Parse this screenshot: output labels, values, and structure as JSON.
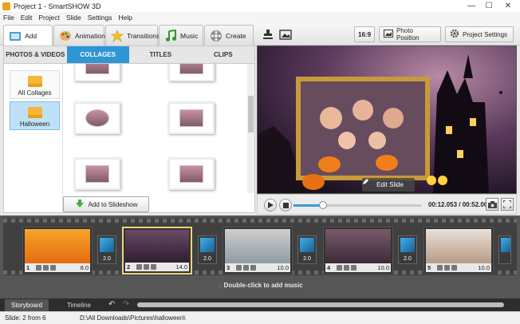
{
  "window": {
    "title": "Project 1 - SmartSHOW 3D",
    "minimize": "—",
    "maximize": "☐",
    "close": "✕"
  },
  "menu": [
    "File",
    "Edit",
    "Project",
    "Slide",
    "Settings",
    "Help"
  ],
  "main_tabs": [
    {
      "label": "Add",
      "icon": "add-media-icon"
    },
    {
      "label": "Animation",
      "icon": "palette-icon"
    },
    {
      "label": "Transitions",
      "icon": "star-icon"
    },
    {
      "label": "Music",
      "icon": "music-note-icon"
    },
    {
      "label": "Create",
      "icon": "film-reel-icon"
    }
  ],
  "toolbar": {
    "aspect_label": "16:9",
    "photo_position_label": "Photo Position",
    "project_settings_label": "Project Settings",
    "tool_icons": [
      "stamp-icon",
      "image-mountain-icon"
    ]
  },
  "sub_tabs": [
    "PHOTOS & VIDEOS",
    "COLLAGES",
    "TITLES",
    "CLIPS"
  ],
  "active_sub_tab": "COLLAGES",
  "categories": [
    {
      "label": "All Collages"
    },
    {
      "label": "Halloween"
    }
  ],
  "add_to_slideshow_label": "Add to Slideshow",
  "preview": {
    "edit_slide_label": "Edit Slide",
    "timecode": "00:12.053 / 00:52.000",
    "progress": 0.23
  },
  "slides": [
    {
      "num": "1",
      "duration": "8.0"
    },
    {
      "num": "2",
      "duration": "14.0"
    },
    {
      "num": "3",
      "duration": "10.0"
    },
    {
      "num": "4",
      "duration": "10.0"
    },
    {
      "num": "5",
      "duration": "10.0"
    }
  ],
  "transitions": [
    "2.0",
    "2.0",
    "2.0",
    "2.0"
  ],
  "music_hint": "Double-click to add music",
  "bottom_tabs": [
    "Storyboard",
    "Timeline"
  ],
  "status": {
    "slide_info": "Slide: 2 from 6",
    "path": "D:\\All Downloads\\Pictures\\halloween\\"
  },
  "colors": {
    "accent": "#2f96d5",
    "active_slide_border": "#f0d27c",
    "timeline_bg": "#565656"
  }
}
